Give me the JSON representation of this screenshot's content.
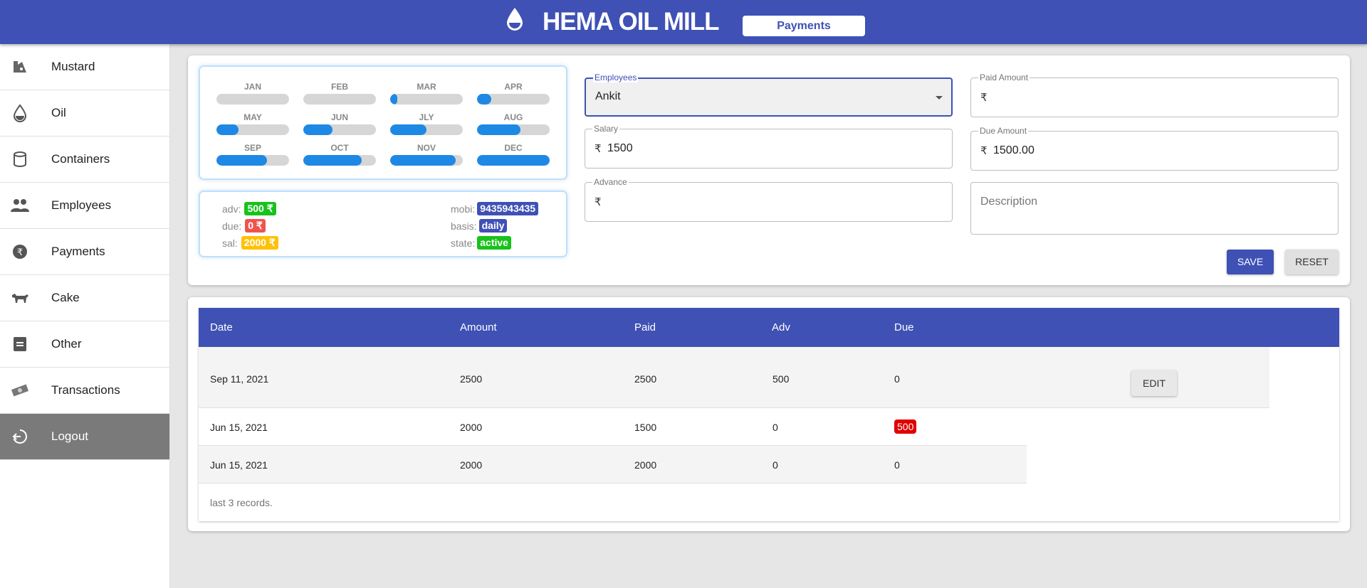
{
  "header": {
    "app_title": "HEMA OIL MILL",
    "page_chip": "Payments",
    "brand_color": "#3f51b5"
  },
  "sidebar": {
    "items": [
      {
        "label": "Mustard",
        "icon": "mustard-icon"
      },
      {
        "label": "Oil",
        "icon": "oil-drop-icon"
      },
      {
        "label": "Containers",
        "icon": "container-icon"
      },
      {
        "label": "Employees",
        "icon": "people-icon"
      },
      {
        "label": "Payments",
        "icon": "rupee-icon"
      },
      {
        "label": "Cake",
        "icon": "cattle-icon"
      },
      {
        "label": "Other",
        "icon": "note-icon"
      },
      {
        "label": "Transactions",
        "icon": "money-icon"
      },
      {
        "label": "Logout",
        "icon": "logout-icon",
        "active": true
      }
    ]
  },
  "months": [
    {
      "label": "JAN",
      "progress": 0
    },
    {
      "label": "FEB",
      "progress": 0
    },
    {
      "label": "MAR",
      "progress": 0.1
    },
    {
      "label": "APR",
      "progress": 0.2
    },
    {
      "label": "MAY",
      "progress": 0.3
    },
    {
      "label": "JUN",
      "progress": 0.4
    },
    {
      "label": "JLY",
      "progress": 0.5
    },
    {
      "label": "AUG",
      "progress": 0.6
    },
    {
      "label": "SEP",
      "progress": 0.7
    },
    {
      "label": "OCT",
      "progress": 0.8
    },
    {
      "label": "NOV",
      "progress": 0.9
    },
    {
      "label": "DEC",
      "progress": 1.0
    }
  ],
  "info": {
    "adv_label": "adv:",
    "adv_value": "500 ₹",
    "due_label": "due:",
    "due_value": "0 ₹",
    "sal_label": "sal:",
    "sal_value": "2000 ₹",
    "mobi_label": "mobi:",
    "mobi_value": "9435943435",
    "basis_label": "basis:",
    "basis_value": "daily",
    "state_label": "state:",
    "state_value": "active"
  },
  "form": {
    "employees_label": "Employees",
    "employees_value": "Ankit",
    "salary_label": "Salary",
    "salary_value": "1500",
    "advance_label": "Advance",
    "advance_value": "",
    "paid_label": "Paid Amount",
    "paid_value": "",
    "due_label": "Due Amount",
    "due_value": "1500.00",
    "description_placeholder": "Description",
    "currency": "₹",
    "save_label": "SAVE",
    "reset_label": "RESET"
  },
  "table": {
    "headers": [
      "Date",
      "Amount",
      "Paid",
      "Adv",
      "Due"
    ],
    "rows": [
      {
        "date": "Sep 11, 2021",
        "amount": "2500",
        "paid": "2500",
        "adv": "500",
        "due": "0",
        "edit": "EDIT"
      },
      {
        "date": "Jun 15, 2021",
        "amount": "2000",
        "paid": "1500",
        "adv": "0",
        "due": "500"
      },
      {
        "date": "Jun 15, 2021",
        "amount": "2000",
        "paid": "2000",
        "adv": "0",
        "due": "0"
      }
    ],
    "footer": "last 3 records."
  }
}
